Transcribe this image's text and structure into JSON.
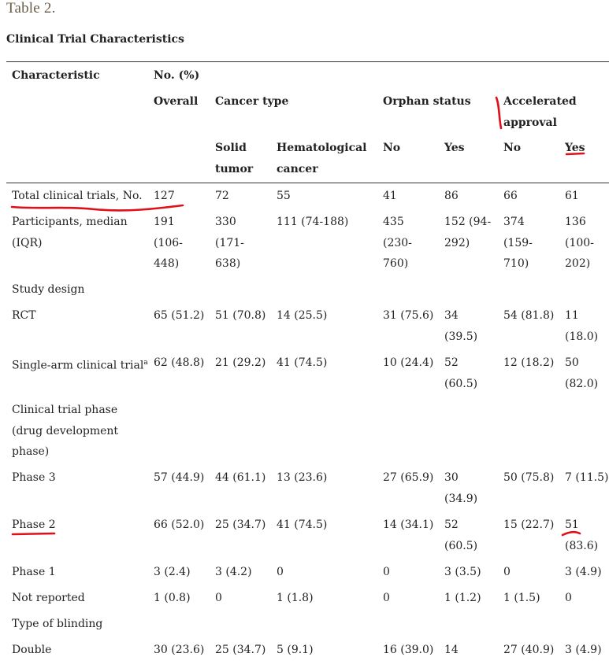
{
  "table_label": "Table 2.",
  "caption": "Clinical Trial Characteristics",
  "headers": {
    "characteristic": "Characteristic",
    "no_pct": "No. (%)",
    "overall": "Overall",
    "cancer_type": "Cancer type",
    "orphan_status": "Orphan status",
    "accelerated_approval": "Accelerated approval",
    "solid_tumor": "Solid tumor",
    "hematological_cancer": "Hematological cancer",
    "no": "No",
    "yes": "Yes"
  },
  "rows": [
    {
      "label": "Total clinical trials, No.",
      "cells": [
        "127",
        "72",
        "55",
        "41",
        "86",
        "66",
        "61"
      ]
    },
    {
      "label": "Participants, median (IQR)",
      "cells": [
        "191 (106-448)",
        "330 (171-638)",
        "111 (74-188)",
        "435 (230-760)",
        "152 (94-292)",
        "374 (159-710)",
        "136 (100-202)"
      ]
    },
    {
      "label": "Study design",
      "cells": []
    },
    {
      "label": "RCT",
      "cells": [
        "65 (51.2)",
        "51 (70.8)",
        "14 (25.5)",
        "31 (75.6)",
        "34 (39.5)",
        "54 (81.8)",
        "11 (18.0)"
      ]
    },
    {
      "label": "Single-arm clinical trial",
      "sup": "a",
      "cells": [
        "62 (48.8)",
        "21 (29.2)",
        "41 (74.5)",
        "10 (24.4)",
        "52 (60.5)",
        "12 (18.2)",
        "50 (82.0)"
      ]
    },
    {
      "label": "Clinical trial phase (drug development phase)",
      "cells": []
    },
    {
      "label": "Phase 3",
      "cells": [
        "57 (44.9)",
        "44 (61.1)",
        "13 (23.6)",
        "27 (65.9)",
        "30 (34.9)",
        "50 (75.8)",
        "7 (11.5)"
      ]
    },
    {
      "label": "Phase 2",
      "cells": [
        "66 (52.0)",
        "25 (34.7)",
        "41 (74.5)",
        "14 (34.1)",
        "52 (60.5)",
        "15 (22.7)",
        "51 (83.6)"
      ]
    },
    {
      "label": "Phase 1",
      "cells": [
        "3 (2.4)",
        "3 (4.2)",
        "0",
        "0",
        "3 (3.5)",
        "0",
        "3 (4.9)"
      ]
    },
    {
      "label": "Not reported",
      "cells": [
        "1 (0.8)",
        "0",
        "1 (1.8)",
        "0",
        "1 (1.2)",
        "1 (1.5)",
        "0"
      ]
    },
    {
      "label": "Type of blinding",
      "cells": []
    },
    {
      "label": "Double",
      "cells": [
        "30 (23.6)",
        "25 (34.7)",
        "5 (9.1)",
        "16 (39.0)",
        "14",
        "27 (40.9)",
        "3 (4.9)"
      ]
    }
  ],
  "colors": {
    "annotation": "#e0101a",
    "caption": "#6b5d4a",
    "text": "#222222"
  }
}
